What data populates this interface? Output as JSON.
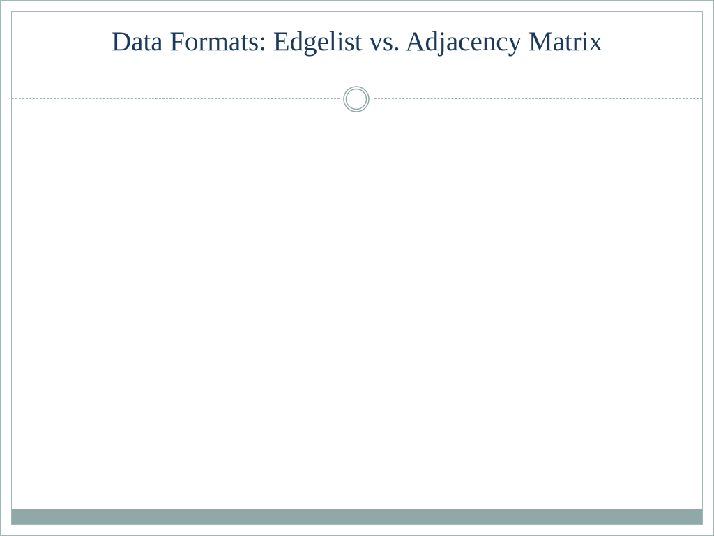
{
  "slide": {
    "title": "Data Formats: Edgelist vs. Adjacency Matrix"
  },
  "theme": {
    "title_color": "#1a3a5c",
    "accent_color": "#8fa8a8",
    "border_color": "#a0b8b8"
  }
}
